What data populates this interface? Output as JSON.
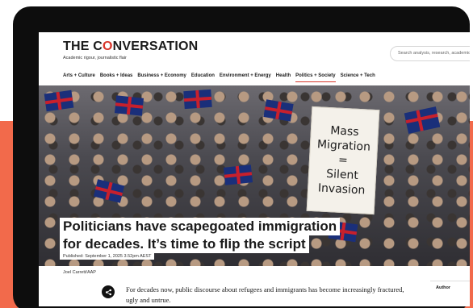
{
  "header": {
    "logo_pre": "THE C",
    "logo_mark": "O",
    "logo_post": "NVERSATION",
    "tagline": "Academic rigour, journalistic flair",
    "search_placeholder": "Search analysis, research, academics..."
  },
  "nav": {
    "items": [
      {
        "label": "Arts + Culture",
        "active": false
      },
      {
        "label": "Books + Ideas",
        "active": false
      },
      {
        "label": "Business + Economy",
        "active": false
      },
      {
        "label": "Education",
        "active": false
      },
      {
        "label": "Environment + Energy",
        "active": false
      },
      {
        "label": "Health",
        "active": false
      },
      {
        "label": "Politics + Society",
        "active": true
      },
      {
        "label": "Science + Tech",
        "active": false
      }
    ]
  },
  "hero": {
    "sign_lines": [
      "Mass",
      "Migration",
      "=",
      "Silent",
      "Invasion"
    ]
  },
  "article": {
    "headline_line1": "Politicians have scapegoated immigration",
    "headline_line2": "for decades. It’s time to flip the script",
    "published": "Published: September 1, 2025 3.52pm AEST",
    "photo_credit": "Joel Carrett/AAP",
    "intro": "For decades now, public discourse about refugees and immigrants has become increasingly fractured, ugly and untrue."
  },
  "sidebar": {
    "author_label": "Author"
  },
  "colors": {
    "accent": "#d8352a",
    "background_band": "#f26a4b",
    "tablet_frame": "#0d0d0d"
  }
}
